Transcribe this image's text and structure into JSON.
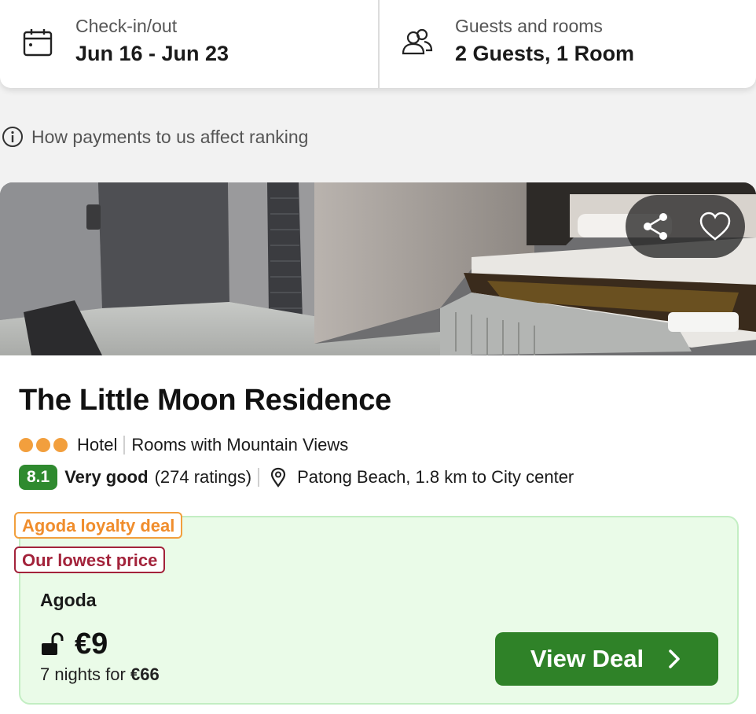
{
  "search": {
    "checkin_label": "Check-in/out",
    "checkin_value": "Jun 16 - Jun 23",
    "guests_label": "Guests and rooms",
    "guests_value": "2 Guests, 1 Room"
  },
  "ranking_note": "How payments to us affect ranking",
  "hotel": {
    "name": "The Little Moon Residence",
    "star_count": 3,
    "type": "Hotel",
    "feature": "Rooms with Mountain Views",
    "score": "8.1",
    "rating_word": "Very good",
    "rating_count": "(274 ratings)",
    "location": "Patong Beach, 1.8 km to City center"
  },
  "deal": {
    "tag_loyalty": "Agoda loyalty deal",
    "tag_lowest": "Our lowest price",
    "provider": "Agoda",
    "price": "€9",
    "nights_prefix": "7 nights for",
    "total": "€66",
    "button_label": "View Deal"
  },
  "icons": {
    "calendar": "calendar-icon",
    "guests": "users-icon",
    "info": "info-icon",
    "share": "share-icon",
    "favorite": "heart-icon",
    "location": "map-pin-icon",
    "lock": "unlock-icon",
    "chevron": "chevron-right-icon"
  },
  "colors": {
    "score_badge": "#2f8a2f",
    "star_dot": "#f29f3d",
    "button": "#2f8228",
    "deal_bg": "#eafbe8",
    "tag_loyalty": "#f08d2c",
    "tag_lowest": "#a3233b"
  }
}
